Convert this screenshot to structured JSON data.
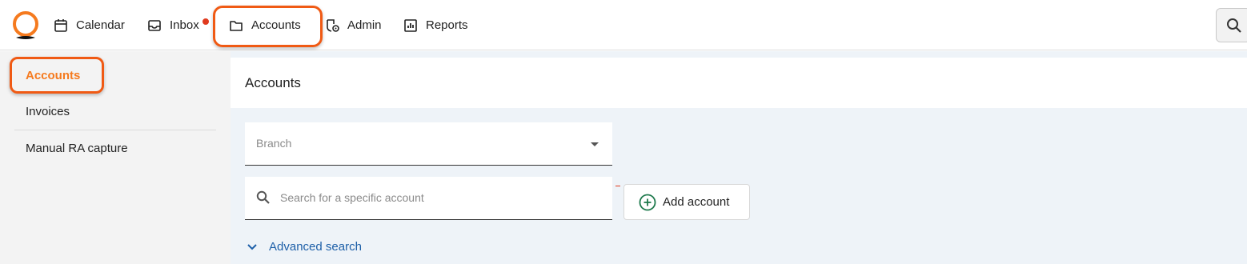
{
  "nav": {
    "items": [
      {
        "label": "Calendar",
        "icon": "calendar-icon"
      },
      {
        "label": "Inbox",
        "icon": "inbox-icon",
        "has_notification": true
      },
      {
        "label": "Accounts",
        "icon": "folder-icon",
        "active": true
      },
      {
        "label": "Admin",
        "icon": "admin-gear-icon"
      },
      {
        "label": "Reports",
        "icon": "reports-chart-icon"
      }
    ]
  },
  "sidebar": {
    "items": [
      {
        "label": "Accounts",
        "active": true
      },
      {
        "label": "Invoices"
      },
      {
        "label": "Manual RA capture"
      }
    ]
  },
  "main": {
    "title": "Accounts",
    "branch": {
      "label": "Branch",
      "value": ""
    },
    "search": {
      "placeholder": "Search for a specific account",
      "value": ""
    },
    "add_account_label": "Add account",
    "advanced_search_label": "Advanced search"
  },
  "colors": {
    "brand_orange": "#f57a1e",
    "highlight": "#f05a14",
    "link_blue": "#1d5fa8",
    "add_icon_green": "#1f7a4d",
    "notification_red": "#e03a1e"
  }
}
